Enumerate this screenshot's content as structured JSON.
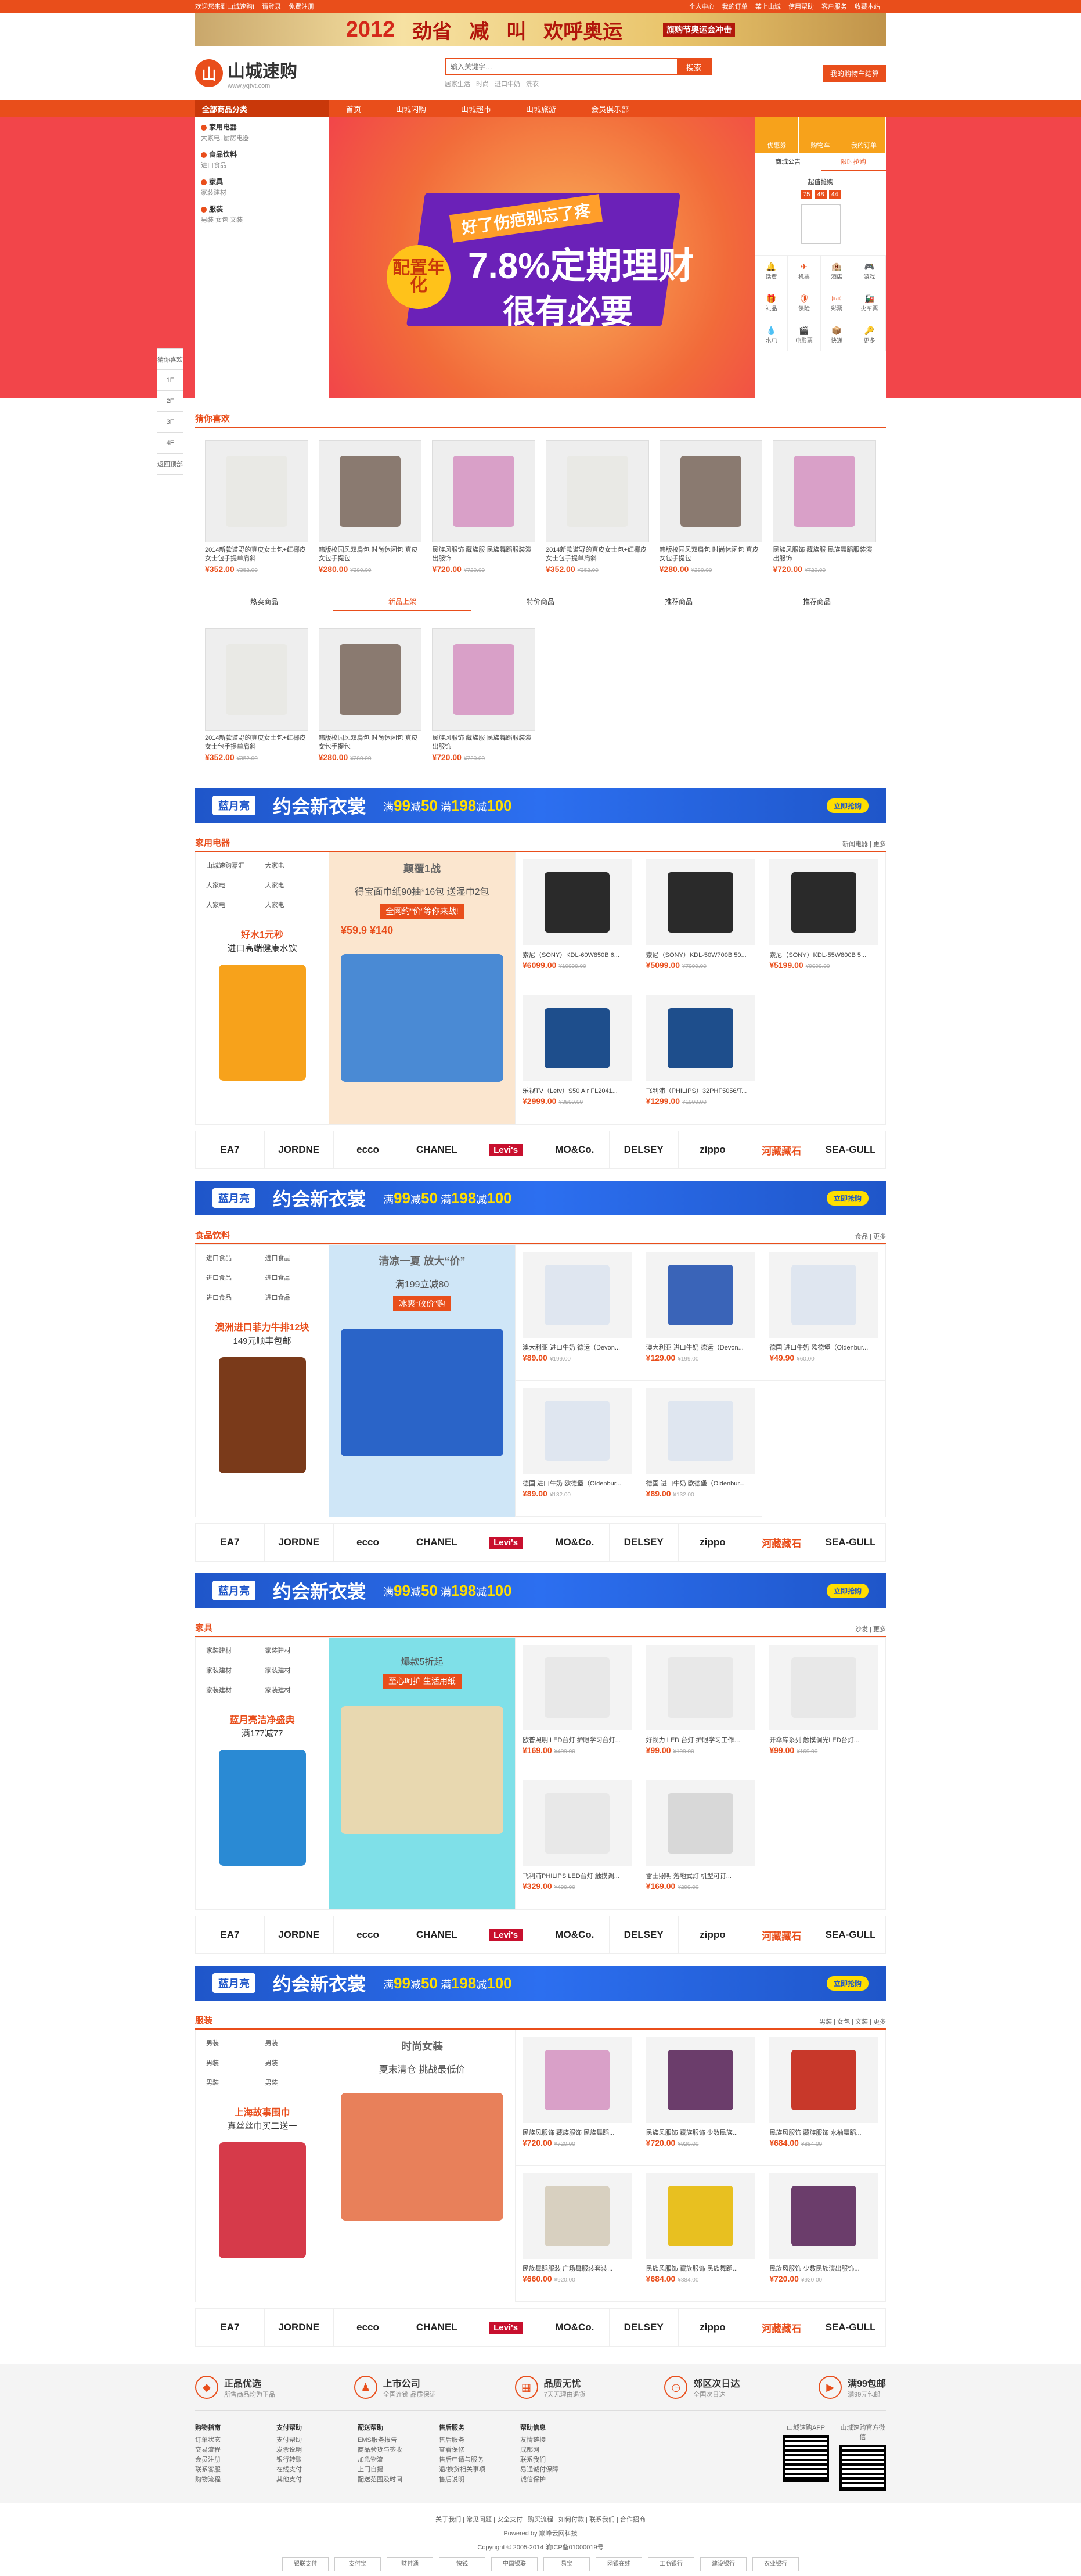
{
  "topbar": {
    "left": [
      "欢迎您来到山城速购!",
      "请登录",
      "免费注册"
    ],
    "right": [
      "个人中心",
      "我的订单",
      "某上山城",
      "使用帮助",
      "客户服务",
      "收藏本站"
    ]
  },
  "topbanner": {
    "year": "2012",
    "t1": "劲省",
    "t2": "减",
    "t3": "叫",
    "t4": "欢呼奥运",
    "small": "旗购节奥运会冲击"
  },
  "logo": {
    "mark": "山",
    "name": "山城速购",
    "url": "www.yqtvt.com"
  },
  "search": {
    "placeholder": "输入关键字…",
    "button": "搜索",
    "hot": [
      "居家生活",
      "时尚",
      "进口牛奶",
      "洗衣"
    ]
  },
  "cart": "我的购物车结算",
  "nav": {
    "all": "全部商品分类",
    "items": [
      "首页",
      "山城闪购",
      "山城超市",
      "山城旅游",
      "会员俱乐部"
    ]
  },
  "cats": [
    {
      "name": "家用电器",
      "sub": "大家电, 厨房电器"
    },
    {
      "name": "食品饮料",
      "sub": "进口食品"
    },
    {
      "name": "家具",
      "sub": "家装建材"
    },
    {
      "name": "服装",
      "sub": "男装 女包 文装"
    }
  ],
  "slide": {
    "tag": "好了伤疤别忘了疼",
    "big": "7.8%定期理财",
    "big2": "很有必要",
    "badge": "配置年化"
  },
  "rpanel": {
    "icons": [
      "优惠券",
      "购物车",
      "我的订单"
    ],
    "tabs": [
      "商城公告",
      "限时抢购"
    ],
    "deal": "超值抢购",
    "cd": [
      "75",
      "48",
      "44"
    ],
    "grid": [
      [
        "🔔",
        "话费"
      ],
      [
        "✈",
        "机票"
      ],
      [
        "🏨",
        "酒店"
      ],
      [
        "🎮",
        "游戏"
      ],
      [
        "🎁",
        "礼品"
      ],
      [
        "🛡",
        "保险"
      ],
      [
        "🎟",
        "彩票"
      ],
      [
        "🚂",
        "火车票"
      ],
      [
        "💧",
        "水电"
      ],
      [
        "🎬",
        "电影票"
      ],
      [
        "📦",
        "快递"
      ],
      [
        "🔑",
        "更多"
      ]
    ]
  },
  "floatnav": [
    "猜你喜欢",
    "1F",
    "2F",
    "3F",
    "4F",
    "返回顶部"
  ],
  "guess": {
    "title": "猜你喜欢",
    "row1": [
      {
        "name": "2014新款道野的真皮女士包+红椰皮女士包手提单肩斜",
        "price": "¥352.00",
        "old": "¥352.00",
        "img": "bag"
      },
      {
        "name": "韩版校园风双肩包 时尚休闲包 真皮女包手提包",
        "price": "¥280.00",
        "old": "¥280.00",
        "img": "backpack"
      },
      {
        "name": "民族风服饰 藏族服 民族舞蹈服装演出服饰",
        "price": "¥720.00",
        "old": "¥720.00",
        "img": "dress"
      },
      {
        "name": "2014新款道野的真皮女士包+红椰皮女士包手提单肩斜",
        "price": "¥352.00",
        "old": "¥352.00",
        "img": "bag"
      },
      {
        "name": "韩版校园风双肩包 时尚休闲包 真皮女包手提包",
        "price": "¥280.00",
        "old": "¥280.00",
        "img": "backpack"
      },
      {
        "name": "民族风服饰 藏族服 民族舞蹈服装演出服饰",
        "price": "¥720.00",
        "old": "¥720.00",
        "img": "dress"
      }
    ],
    "tabs": [
      "热卖商品",
      "新品上架",
      "特价商品",
      "推荐商品",
      "推荐商品"
    ],
    "row2": [
      {
        "name": "2014新款道野的真皮女士包+红椰皮女士包手提单肩斜",
        "price": "¥352.00",
        "old": "¥352.00",
        "img": "bag"
      },
      {
        "name": "韩版校园风双肩包 时尚休闲包 真皮女包手提包",
        "price": "¥280.00",
        "old": "¥280.00",
        "img": "backpack"
      },
      {
        "name": "民族风服饰 藏族服 民族舞蹈服装演出服饰",
        "price": "¥720.00",
        "old": "¥720.00",
        "img": "dress"
      }
    ]
  },
  "ad": {
    "logo": "蓝月亮",
    "slogan": "约会新衣裳",
    "p1": "满",
    "v1": "99",
    "p2": "减",
    "v2": "50",
    "p3": "满",
    "v3": "198",
    "p4": "减",
    "v4": "100",
    "btn": "立即抢购"
  },
  "brands": [
    "EA7",
    "JORDNE",
    "ecco",
    "CHANEL",
    "Levi's",
    "MO&Co.",
    "DELSEY",
    "zippo",
    "河藏藏石",
    "SEA-GULL"
  ],
  "floors": [
    {
      "title": "家用电器",
      "more": "新闻电器 | 更多",
      "links": [
        "山城速购嘉汇",
        "大家电",
        "大家电",
        "大家电",
        "大家电",
        "大家电"
      ],
      "p1": "好水1元秒",
      "p2": "进口高端健康水饮",
      "mid": {
        "h": "颠覆1战",
        "s1": "得宝面巾纸90抽*16包 送湿巾2包",
        "s2": "全网约“价”等你来战!",
        "s3": "¥59.9 ¥140"
      },
      "prods": [
        {
          "name": "索尼（SONY）KDL-60W850B 6...",
          "price": "¥6099.00",
          "old": "¥10999.00",
          "img": "tv"
        },
        {
          "name": "索尼（SONY）KDL-50W700B 50...",
          "price": "¥5099.00",
          "old": "¥7999.00",
          "img": "tv"
        },
        {
          "name": "索尼（SONY）KDL-55W800B 5...",
          "price": "¥5199.00",
          "old": "¥9999.00",
          "img": "tv"
        },
        {
          "name": "乐视TV（Letv）S50 Air FL2041...",
          "price": "¥2999.00",
          "old": "¥3599.00",
          "img": "tvblue"
        },
        {
          "name": "飞利浦（PHILIPS）32PHF5056/T...",
          "price": "¥1299.00",
          "old": "¥1999.00",
          "img": "tvblue"
        }
      ]
    },
    {
      "title": "食品饮料",
      "more": "食品 | 更多",
      "links": [
        "进口食品",
        "进口食品",
        "进口食品",
        "进口食品",
        "进口食品",
        "进口食品"
      ],
      "p1": "澳洲进口菲力牛排12块",
      "p2": "149元顺丰包邮",
      "mid": {
        "h": "清凉一夏 放大“价”",
        "s1": "满199立减80",
        "s2": "冰爽“放价”购",
        "s3": ""
      },
      "prods": [
        {
          "name": "澳大利亚 进口牛奶 德运（Devon...",
          "price": "¥89.00",
          "old": "¥199.00",
          "img": "milk"
        },
        {
          "name": "澳大利亚 进口牛奶 德运（Devon...",
          "price": "¥129.00",
          "old": "¥199.00",
          "img": "milkblue"
        },
        {
          "name": "德国 进口牛奶 欧德堡（Oldenbur...",
          "price": "¥49.90",
          "old": "¥60.00",
          "img": "milk"
        },
        {
          "name": "德国 进口牛奶 欧德堡（Oldenbur...",
          "price": "¥89.00",
          "old": "¥132.00",
          "img": "milk"
        },
        {
          "name": "德国 进口牛奶 欧德堡（Oldenbur...",
          "price": "¥89.00",
          "old": "¥132.00",
          "img": "milk"
        }
      ]
    },
    {
      "title": "家具",
      "more": "沙发 | 更多",
      "links": [
        "家装建材",
        "家装建材",
        "家装建材",
        "家装建材",
        "家装建材",
        "家装建材"
      ],
      "p1": "蓝月亮洁净盛典",
      "p2": "满177减77",
      "mid": {
        "h": "",
        "s1": "爆款5折起",
        "s2": "至心呵护 生活用纸",
        "s3": ""
      },
      "prods": [
        {
          "name": "欧普照明 LED台灯 护眼学习台灯...",
          "price": "¥169.00",
          "old": "¥499.00",
          "img": "lamp"
        },
        {
          "name": "好视力 LED 台灯 护眼学习工作…",
          "price": "¥99.00",
          "old": "¥199.00",
          "img": "lamp"
        },
        {
          "name": "开伞库系列 触摸调光LED台灯...",
          "price": "¥99.00",
          "old": "¥169.00",
          "img": "lamp"
        },
        {
          "name": "飞利浦PHILIPS LED台灯 触摸调...",
          "price": "¥329.00",
          "old": "¥499.00",
          "img": "lamp"
        },
        {
          "name": "雷士照明 落地式灯 机型可订...",
          "price": "¥169.00",
          "old": "¥299.00",
          "img": "floorlamp"
        }
      ]
    },
    {
      "title": "服装",
      "more": "男装 | 女包 | 文装 | 更多",
      "links": [
        "男装",
        "男装",
        "男装",
        "男装",
        "男装",
        "男装"
      ],
      "p1": "上海故事围巾",
      "p2": "真丝丝巾买二送一",
      "mid": {
        "h": "时尚女装",
        "s1": "夏末清仓 挑战最低价",
        "s2": "",
        "s3": ""
      },
      "prods": [
        {
          "name": "民族风服饰 藏族服饰 民族舞蹈...",
          "price": "¥720.00",
          "old": "¥720.00",
          "img": "dress"
        },
        {
          "name": "民族风服饰 藏族服饰 少数民族...",
          "price": "¥720.00",
          "old": "¥920.00",
          "img": "dress2"
        },
        {
          "name": "民族风服饰 藏族服饰 水袖舞蹈...",
          "price": "¥684.00",
          "old": "¥884.00",
          "img": "dress3"
        },
        {
          "name": "民族舞蹈服装 广场舞服装套装...",
          "price": "¥660.00",
          "old": "¥920.00",
          "img": "dress4"
        },
        {
          "name": "民族风服饰 藏族服饰 民族舞蹈...",
          "price": "¥684.00",
          "old": "¥884.00",
          "img": "dress5"
        },
        {
          "name": "民族风服饰 少数民族演出服饰...",
          "price": "¥720.00",
          "old": "¥920.00",
          "img": "dress2"
        }
      ]
    }
  ],
  "services": [
    [
      "◆",
      "正品优选",
      "所售商品均为正品"
    ],
    [
      "♟",
      "上市公司",
      "全国连锁 品质保证"
    ],
    [
      "▦",
      "品质无忧",
      "7天无理由退货"
    ],
    [
      "◷",
      "郊区次日达",
      "全国次日达"
    ],
    [
      "▶",
      "满99包邮",
      "满99元包邮"
    ]
  ],
  "helps": [
    {
      "t": "购物指南",
      "i": [
        "订单状态",
        "交易流程",
        "会员注册",
        "联系客服",
        "购物流程"
      ]
    },
    {
      "t": "支付帮助",
      "i": [
        "支付帮助",
        "发票说明",
        "银行转账",
        "在线支付",
        "其他支付"
      ]
    },
    {
      "t": "配送帮助",
      "i": [
        "EMS服务报告",
        "商品验货与签收",
        "加急物流",
        "上门自提",
        "配送范围及时间"
      ]
    },
    {
      "t": "售后服务",
      "i": [
        "售后服务",
        "查看保修",
        "售后申请与服务",
        "退/换货相关事项",
        "售后说明"
      ]
    },
    {
      "t": "帮助信息",
      "i": [
        "友情链接",
        "成都网",
        "联系我们",
        "易通诚付保障",
        "诚信保护"
      ]
    }
  ],
  "qr": [
    "山城速购APP",
    "山城速购官方微信"
  ],
  "foot": [
    "关于我们 | 常见问题 | 安全支付 | 购买流程 | 如何付款 | 联系我们 | 合作招商",
    "Powered by 巅峰云网科技",
    "Copyright © 2005-2014 渝ICP备01000019号"
  ],
  "pay": [
    "银联支付",
    "支付宝",
    "财付通",
    "快钱",
    "中国银联",
    "易宝",
    "网银在线",
    "工商银行",
    "建设银行",
    "农业银行"
  ]
}
